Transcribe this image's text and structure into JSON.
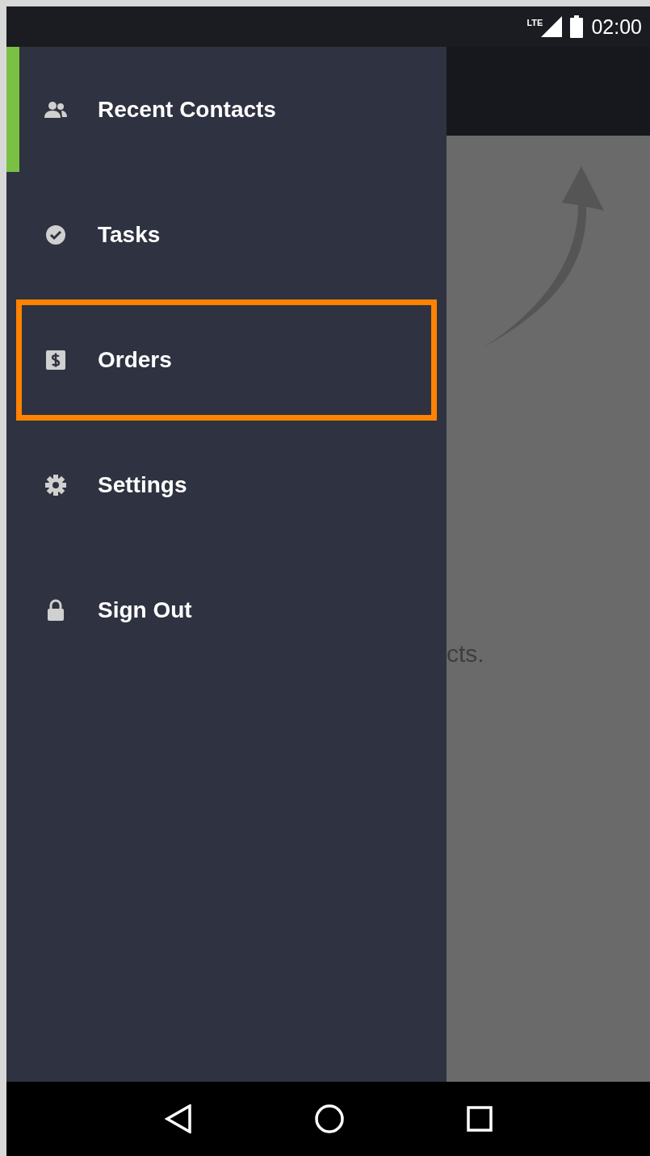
{
  "status_bar": {
    "network": "LTE",
    "time": "02:00"
  },
  "drawer": {
    "items": [
      {
        "kind": "contacts",
        "label": "Recent Contacts",
        "selected": true,
        "highlighted": false
      },
      {
        "kind": "tasks",
        "label": "Tasks",
        "selected": false,
        "highlighted": false
      },
      {
        "kind": "orders",
        "label": "Orders",
        "selected": false,
        "highlighted": true
      },
      {
        "kind": "settings",
        "label": "Settings",
        "selected": false,
        "highlighted": false
      },
      {
        "kind": "signout",
        "label": "Sign Out",
        "selected": false,
        "highlighted": false
      }
    ]
  },
  "background": {
    "text": "cts."
  }
}
